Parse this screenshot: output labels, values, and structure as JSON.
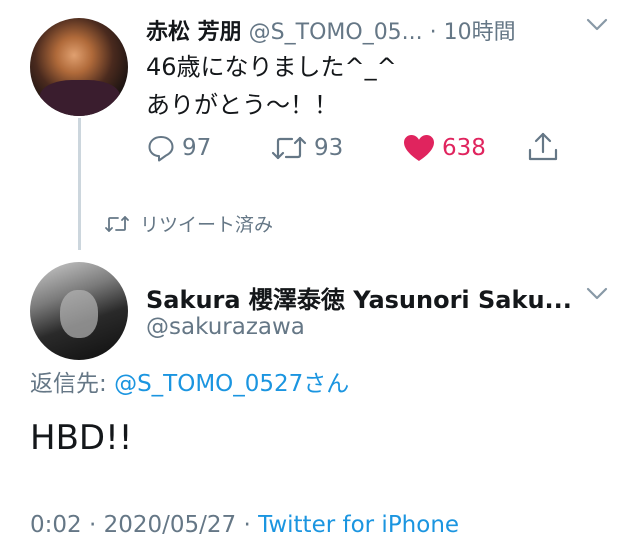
{
  "parent_tweet": {
    "author_name": "赤松 芳朋",
    "author_handle": "@S_TOMO_05...",
    "separator": "·",
    "time_ago": "10時間",
    "text_line1": "46歳になりました^_^",
    "text_line2": "ありがとう〜！！",
    "reply_count": "97",
    "retweet_count": "93",
    "like_count": "638",
    "liked": true,
    "icons": [
      "reply-icon",
      "retweet-icon",
      "heart-icon",
      "share-icon",
      "chevron-down-icon"
    ]
  },
  "retweeted_label": {
    "text": "リツイート済み",
    "icon": "retweet-icon"
  },
  "main_tweet": {
    "author_name": "Sakura 櫻澤泰徳 Yasunori Saku...",
    "author_handle": "@sakurazawa",
    "replying_prefix": "返信先: ",
    "replying_to": "@S_TOMO_0527さん",
    "text": "HBD!!",
    "timestamp": "0:02 · 2020/05/27 · ",
    "source": "Twitter for iPhone"
  },
  "colors": {
    "text": "#14171a",
    "muted": "#657786",
    "link": "#1b95e0",
    "like": "#e0245e",
    "thread_line": "#ccd6dd"
  }
}
